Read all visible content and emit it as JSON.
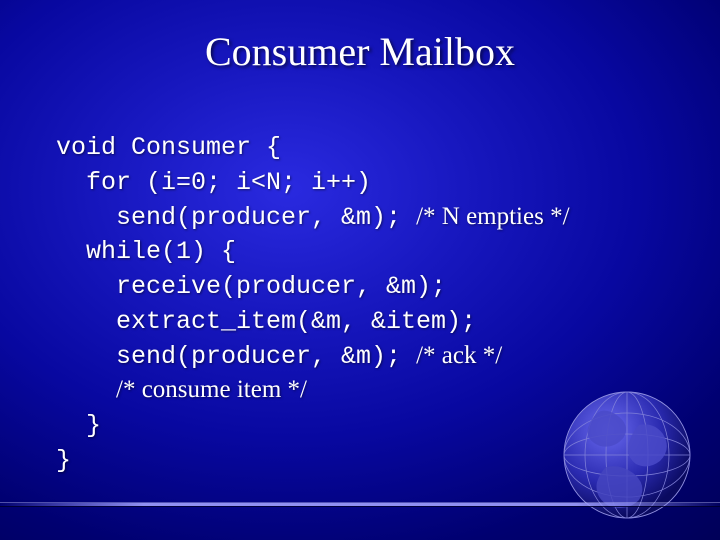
{
  "title": "Consumer Mailbox",
  "code": {
    "l1": "void Consumer {",
    "l2": "  for (i=0; i<N; i++)",
    "l3a": "    send(producer, &m); ",
    "l3b": "/* N empties */",
    "l4": "  while(1) {",
    "l5": "    receive(producer, &m);",
    "l6": "    extract_item(&m, &item);",
    "l7a": "    send(producer, &m); ",
    "l7b": "/* ack */",
    "l8": "    ",
    "l8b": "/* consume item */",
    "l9": "  }",
    "l10": "}"
  }
}
